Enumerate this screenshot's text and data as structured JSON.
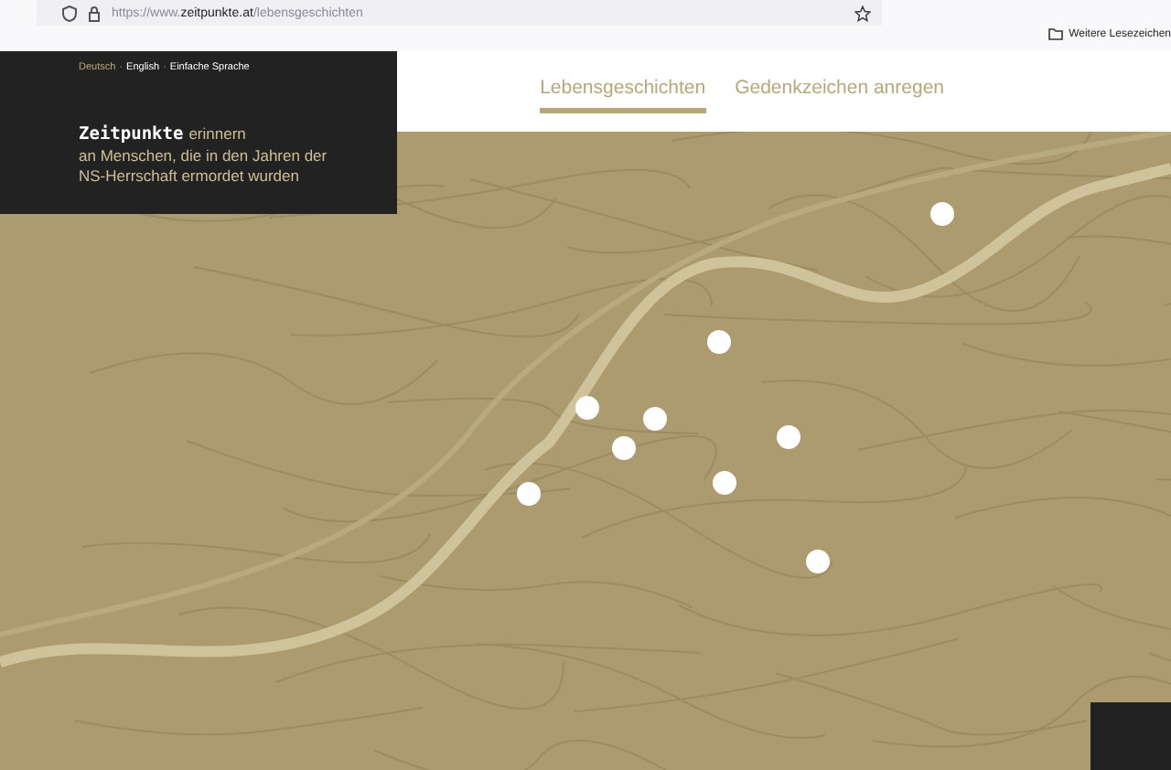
{
  "browser": {
    "url": "https://www.**zeitpunkte.at**/lebensgeschichten",
    "bookmarks_folder": "Weitere Lesezeichen"
  },
  "languages": [
    {
      "label": "Deutsch",
      "selected": true
    },
    {
      "label": "English",
      "selected": false
    },
    {
      "label": "Einfache Sprache",
      "selected": false
    }
  ],
  "separator": "·",
  "intro": {
    "brand": "Zeitpunkte",
    "first_line": "erinnern",
    "lines": [
      "an Menschen, die in den Jahren der",
      "NS-Herrschaft ermordet wurden"
    ]
  },
  "nav": [
    {
      "label": "Lebensgeschichten",
      "selected": true
    },
    {
      "label": "Gedenkzeichen anregen",
      "selected": false
    }
  ]
}
